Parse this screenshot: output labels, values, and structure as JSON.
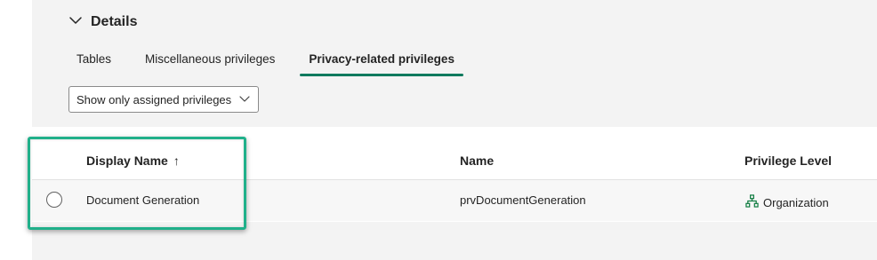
{
  "details": {
    "title": "Details",
    "toggle_icon": "chevron-down-icon"
  },
  "tabs": [
    {
      "label": "Tables",
      "active": false
    },
    {
      "label": "Miscellaneous privileges",
      "active": false
    },
    {
      "label": "Privacy-related privileges",
      "active": true
    }
  ],
  "filter": {
    "selected": "Show only assigned privileges",
    "icon": "chevron-down-icon"
  },
  "grid": {
    "columns": {
      "display_name": "Display Name",
      "sort_indicator": "↑",
      "name": "Name",
      "privilege_level": "Privilege Level"
    },
    "rows": [
      {
        "display_name": "Document Generation",
        "name": "prvDocumentGeneration",
        "privilege_level": "Organization",
        "level_icon": "organization-icon"
      }
    ]
  },
  "colors": {
    "accent": "#0f7a5e",
    "highlight": "#20b08a",
    "org_icon": "#107c41"
  }
}
